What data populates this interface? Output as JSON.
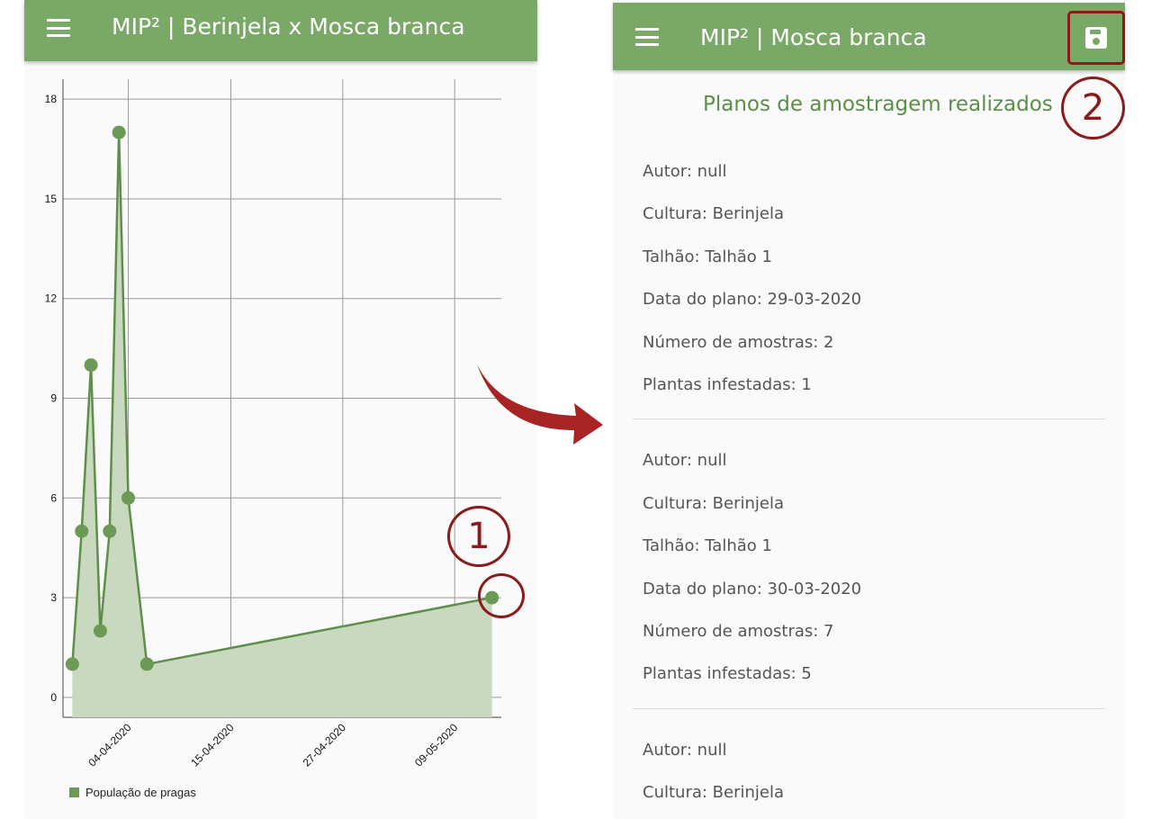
{
  "left_screen": {
    "appbar": {
      "title": "MIP² | Berinjela x Mosca branca",
      "color": "#7aa866"
    },
    "legend": {
      "label": "População de pragas",
      "color": "#6a9a55"
    }
  },
  "chart_data": {
    "type": "area",
    "x_type": "date",
    "x": [
      "2020-03-29",
      "2020-03-30",
      "2020-03-31",
      "2020-04-01",
      "2020-04-02",
      "2020-04-03",
      "2020-04-04",
      "2020-04-06",
      "2020-05-13"
    ],
    "series": [
      {
        "name": "População de pragas",
        "values": [
          1,
          5,
          10,
          2,
          5,
          17,
          6,
          1,
          3
        ]
      }
    ],
    "xticks": [
      "04-04-2020",
      "15-04-2020",
      "27-04-2020",
      "09-05-2020"
    ],
    "xtick_dates": [
      "2020-04-04",
      "2020-04-15",
      "2020-04-27",
      "2020-05-09"
    ],
    "xlim": [
      "2020-03-28",
      "2020-05-14"
    ],
    "yticks": [
      0,
      3,
      6,
      9,
      12,
      15,
      18
    ],
    "ylim": [
      -0.6,
      18.6
    ],
    "grid": true,
    "legend": "bottom-left",
    "line_color": "#5e8f4a",
    "fill_color": "#c8d9bf"
  },
  "right_screen": {
    "appbar": {
      "title": "MIP² | Mosca branca",
      "save_icon": "save-icon"
    },
    "section_title": "Planos de amostragem realizados",
    "plans": [
      {
        "author": "Autor: null",
        "culture": "Cultura: Berinjela",
        "plot": "Talhão: Talhão 1",
        "date": "Data do plano: 29-03-2020",
        "samples": "Número de amostras: 2",
        "infested": "Plantas infestadas: 1"
      },
      {
        "author": "Autor: null",
        "culture": "Cultura: Berinjela",
        "plot": "Talhão: Talhão 1",
        "date": "Data do plano: 30-03-2020",
        "samples": "Número de amostras: 7",
        "infested": "Plantas infestadas: 5"
      },
      {
        "author": "Autor: null",
        "culture": "Cultura: Berinjela"
      }
    ]
  },
  "annotations": {
    "badge_1": "1",
    "badge_2": "2",
    "accent_color": "#8b1a1a"
  }
}
